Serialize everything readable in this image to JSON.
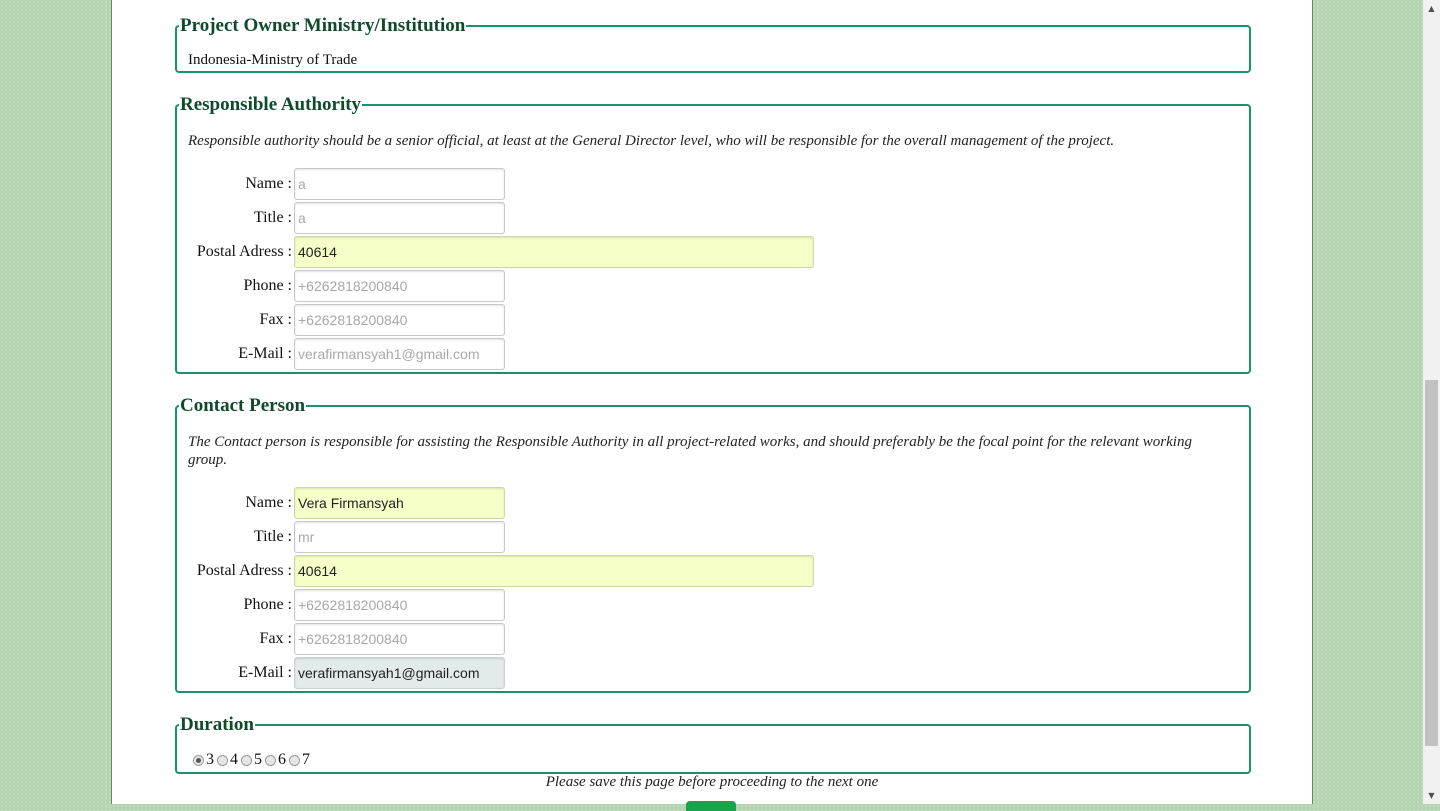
{
  "owner": {
    "legend": "Project Owner Ministry/Institution",
    "value": "Indonesia-Ministry of Trade"
  },
  "responsible": {
    "legend": "Responsible Authority",
    "description": "Responsible authority should be a senior official, at least at the General Director level, who will be responsible for the overall management of the project.",
    "fields": {
      "name": {
        "label": "Name :",
        "value": "",
        "placeholder": "a"
      },
      "title": {
        "label": "Title :",
        "value": "",
        "placeholder": "a"
      },
      "postal": {
        "label": "Postal Adress :",
        "value": "40614",
        "placeholder": ""
      },
      "phone": {
        "label": "Phone :",
        "value": "",
        "placeholder": "+6262818200840"
      },
      "fax": {
        "label": "Fax :",
        "value": "",
        "placeholder": "+6262818200840"
      },
      "email": {
        "label": "E-Mail :",
        "value": "",
        "placeholder": "verafirmansyah1@gmail.com"
      }
    }
  },
  "contact": {
    "legend": "Contact Person",
    "description": "The Contact person is responsible for assisting the Responsible Authority in all project-related works, and should preferably be the focal point for the relevant working group.",
    "fields": {
      "name": {
        "label": "Name :",
        "value": "Vera Firmansyah",
        "placeholder": ""
      },
      "title": {
        "label": "Title :",
        "value": "",
        "placeholder": "mr"
      },
      "postal": {
        "label": "Postal Adress :",
        "value": "40614",
        "placeholder": ""
      },
      "phone": {
        "label": "Phone :",
        "value": "",
        "placeholder": "+6262818200840"
      },
      "fax": {
        "label": "Fax :",
        "value": "",
        "placeholder": "+6262818200840"
      },
      "email": {
        "label": "E-Mail :",
        "value": "verafirmansyah1@gmail.com",
        "placeholder": ""
      }
    }
  },
  "duration": {
    "legend": "Duration",
    "options": [
      "3",
      "4",
      "5",
      "6",
      "7"
    ],
    "selected": "3"
  },
  "footer_note": "Please save this page before proceeding to the next one",
  "scrollbar": {
    "up_icon": "triangle-up",
    "down_icon": "triangle-down"
  }
}
